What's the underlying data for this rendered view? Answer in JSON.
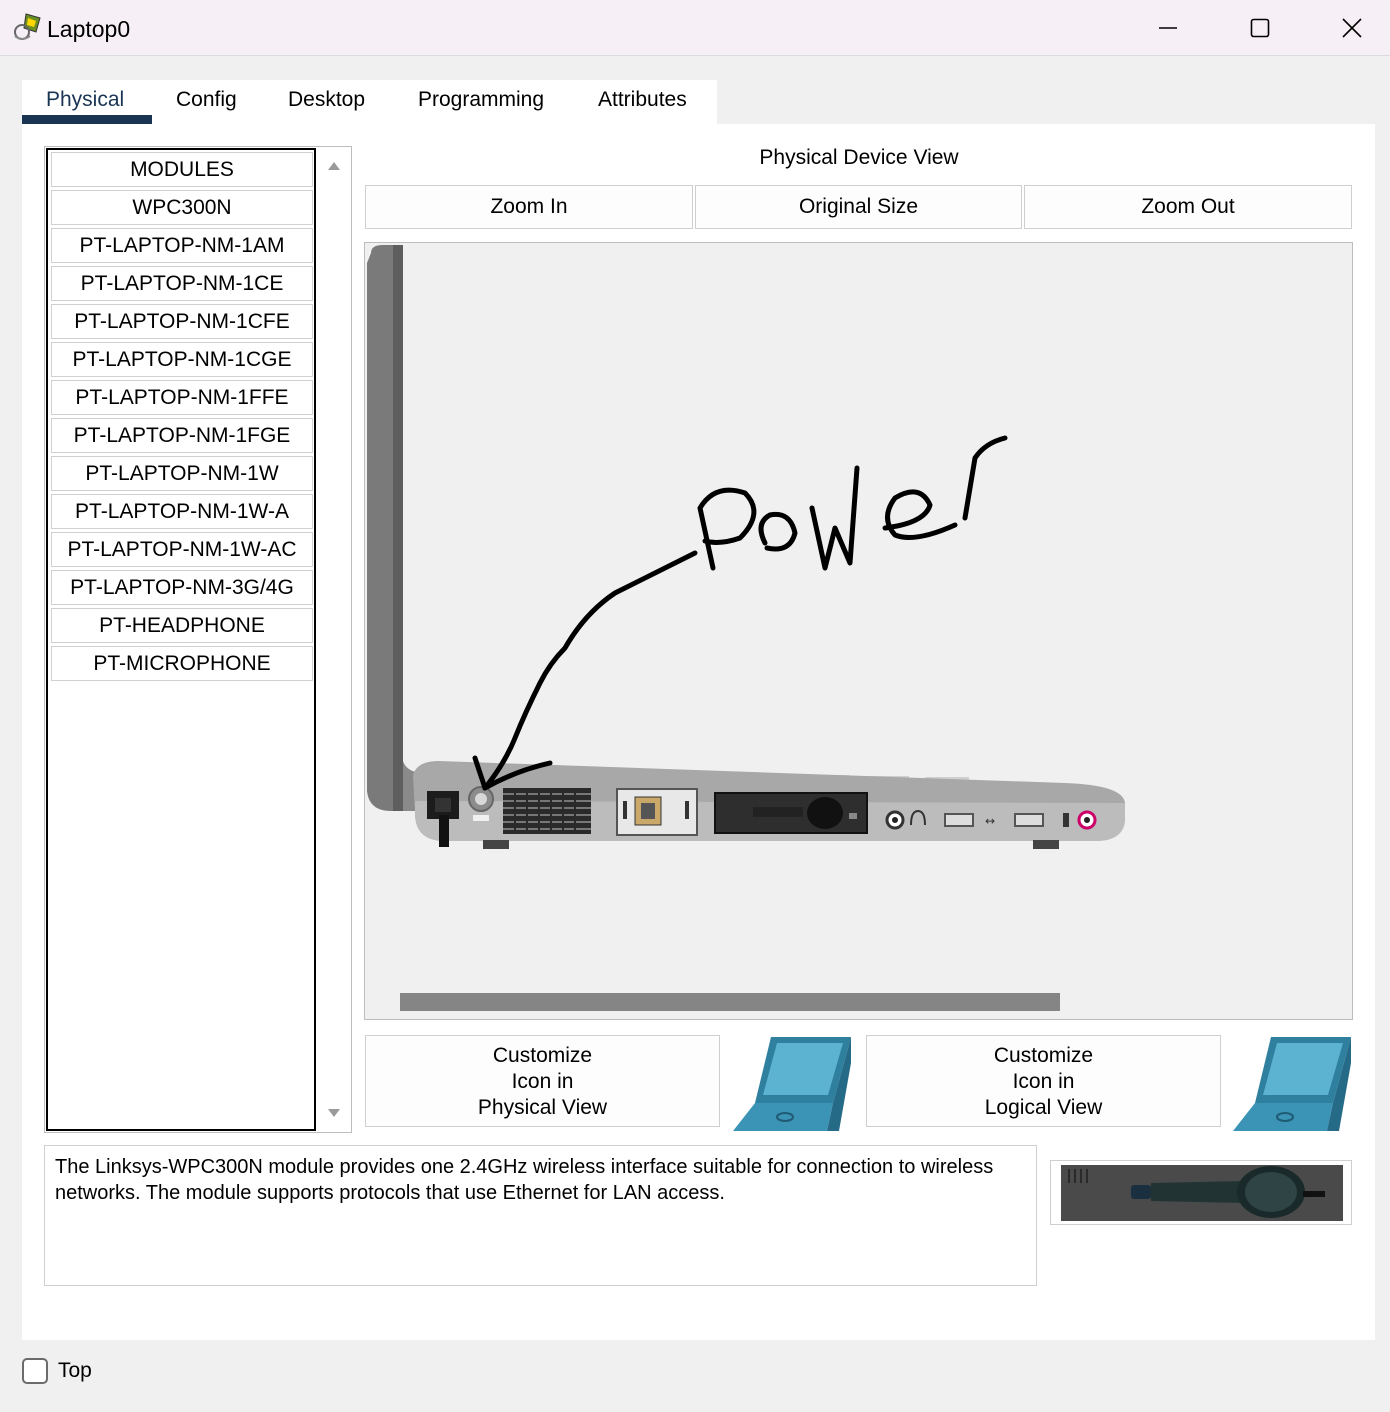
{
  "window": {
    "title": "Laptop0",
    "controls": [
      "minimize-icon",
      "maximize-icon",
      "close-icon"
    ]
  },
  "tabs": [
    {
      "label": "Physical",
      "active": true
    },
    {
      "label": "Config",
      "active": false
    },
    {
      "label": "Desktop",
      "active": false
    },
    {
      "label": "Programming",
      "active": false
    },
    {
      "label": "Attributes",
      "active": false
    }
  ],
  "modules": {
    "header": "MODULES",
    "items": [
      "WPC300N",
      "PT-LAPTOP-NM-1AM",
      "PT-LAPTOP-NM-1CE",
      "PT-LAPTOP-NM-1CFE",
      "PT-LAPTOP-NM-1CGE",
      "PT-LAPTOP-NM-1FFE",
      "PT-LAPTOP-NM-1FGE",
      "PT-LAPTOP-NM-1W",
      "PT-LAPTOP-NM-1W-A",
      "PT-LAPTOP-NM-1W-AC",
      "PT-LAPTOP-NM-3G/4G",
      "PT-HEADPHONE",
      "PT-MICROPHONE"
    ]
  },
  "device_view": {
    "title": "Physical Device View",
    "zoom_in": "Zoom In",
    "original_size": "Original Size",
    "zoom_out": "Zoom Out",
    "annotation": "Power"
  },
  "customize": {
    "physical_l1": "Customize",
    "physical_l2": "Icon in",
    "physical_l3": "Physical View",
    "logical_l1": "Customize",
    "logical_l2": "Icon in",
    "logical_l3": "Logical View"
  },
  "description": "The Linksys-WPC300N module provides one 2.4GHz wireless interface suitable for connection to wireless networks. The module supports protocols that use Ethernet for LAN access.",
  "footer": {
    "top_label": "Top",
    "top_checked": false
  },
  "colors": {
    "tab_underline": "#1a3553",
    "laptop_icon": "#4aa3c3",
    "annotation_ink": "#000000"
  }
}
